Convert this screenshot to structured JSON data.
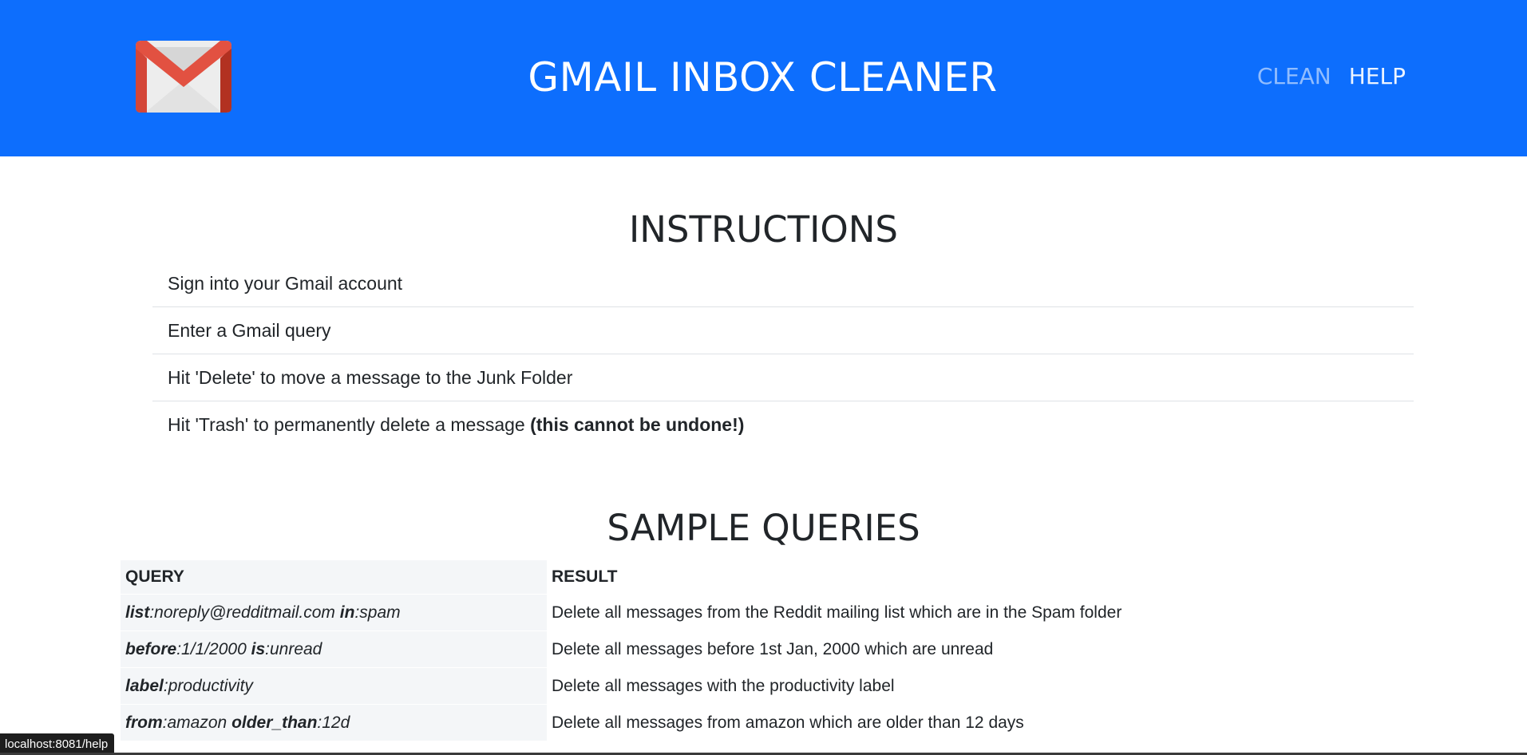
{
  "header": {
    "logo": "gmail-envelope-icon",
    "title": "GMAIL INBOX CLEANER",
    "nav": [
      {
        "label": "CLEAN",
        "state": "inactive"
      },
      {
        "label": "HELP",
        "state": "active"
      }
    ],
    "background_color": "#0d6efd"
  },
  "instructions": {
    "title": "INSTRUCTIONS",
    "items": [
      {
        "text": "Sign into your Gmail account",
        "emphasis": ""
      },
      {
        "text": "Enter a Gmail query",
        "emphasis": ""
      },
      {
        "text": "Hit 'Delete' to move a message to the Junk Folder",
        "emphasis": ""
      },
      {
        "text": "Hit 'Trash' to permanently delete a message ",
        "emphasis": "(this cannot be undone!)"
      }
    ]
  },
  "sample_queries": {
    "title": "SAMPLE QUERIES",
    "columns": [
      "QUERY",
      "RESULT"
    ],
    "rows": [
      {
        "query": [
          {
            "op": "list",
            "val": ":noreply@redditmail.com"
          },
          {
            "op": "in",
            "val": ":spam"
          }
        ],
        "result": "Delete all messages from the Reddit mailing list which are in the Spam folder"
      },
      {
        "query": [
          {
            "op": "before",
            "val": ":1/1/2000"
          },
          {
            "op": "is",
            "val": ":unread"
          }
        ],
        "result": "Delete all messages before 1st Jan, 2000 which are unread"
      },
      {
        "query": [
          {
            "op": "label",
            "val": ":productivity"
          }
        ],
        "result": "Delete all messages with the productivity label"
      },
      {
        "query": [
          {
            "op": "from",
            "val": ":amazon"
          },
          {
            "op": "older_than",
            "val": ":12d"
          }
        ],
        "result": "Delete all messages from amazon which are older than 12 days"
      }
    ]
  },
  "status_bar": {
    "url": "localhost:8081/help"
  }
}
